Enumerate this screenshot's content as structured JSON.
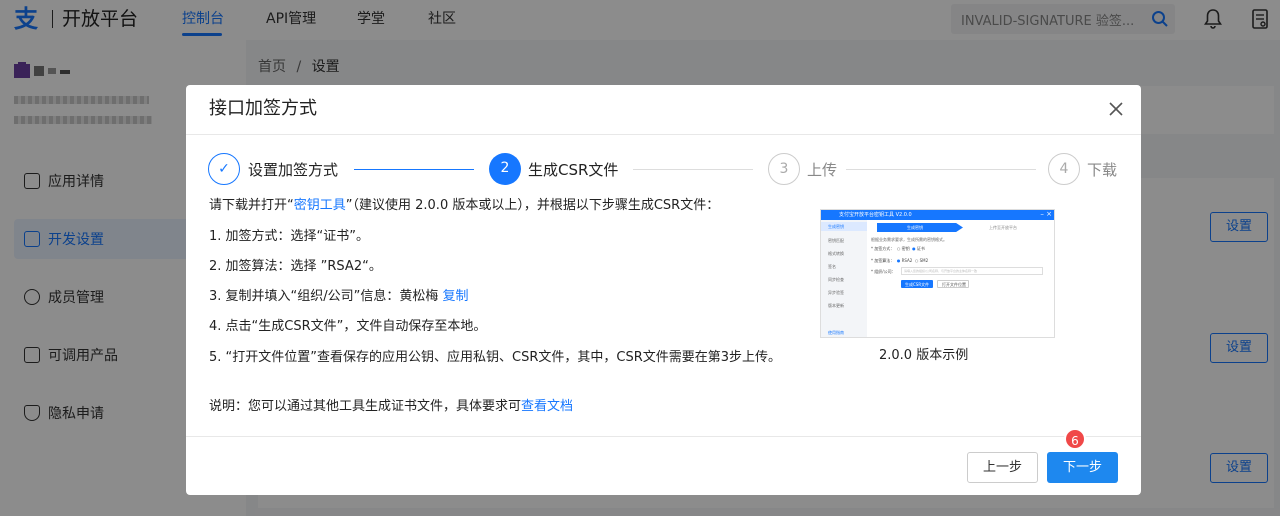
{
  "header": {
    "logo_glyph": "支",
    "logo_text": "开放平台",
    "nav": [
      "控制台",
      "API管理",
      "学堂",
      "社区"
    ],
    "search_text": "INVALID-SIGNATURE 验签..."
  },
  "sidebar": {
    "items": [
      {
        "label": "应用详情",
        "icon": "chart-icon"
      },
      {
        "label": "开发设置",
        "icon": "settings-panel-icon"
      },
      {
        "label": "成员管理",
        "icon": "user-icon"
      },
      {
        "label": "可调用产品",
        "icon": "link-icon"
      },
      {
        "label": "隐私申请",
        "icon": "shield-icon"
      }
    ]
  },
  "breadcrumb": {
    "home": "首页",
    "sep": "/",
    "current": "设置"
  },
  "background_buttons": [
    "设置",
    "设置",
    "设置"
  ],
  "modal": {
    "title": "接口加签方式",
    "steps": [
      {
        "num": "✓",
        "label": "设置加签方式",
        "state": "done"
      },
      {
        "num": "2",
        "label": "生成CSR文件",
        "state": "active"
      },
      {
        "num": "3",
        "label": "上传",
        "state": "pending"
      },
      {
        "num": "4",
        "label": "下载",
        "state": "pending"
      }
    ],
    "intro_pre": "请下载并打开“",
    "intro_link": "密钥工具",
    "intro_post": "”（建议使用 2.0.0 版本或以上），并根据以下步骤生成CSR文件：",
    "line1": "1. 加签方式：选择“证书”。",
    "line2": "2. 加签算法：选择 ”RSA2“。",
    "line3_pre": "3. 复制并填入“组织/公司”信息：黄松梅 ",
    "line3_link": "复制",
    "line4": "4. 点击“生成CSR文件”，文件自动保存至本地。",
    "line5": "5. “打开文件位置”查看保存的应用公钥、应用私钥、CSR文件，其中，CSR文件需要在第3步上传。",
    "note_pre": "说明：您可以通过其他工具生成证书文件，具体要求可",
    "note_link": "查看文档",
    "preview_caption": "2.0.0 版本示例",
    "preview": {
      "title": "支付宝开放平台密钥工具 V2.0.0",
      "side": [
        "生成密钥",
        "密钥匹配",
        "格式转换",
        "签名",
        "同步检查",
        "异步验签",
        "版本更新"
      ],
      "tab1": "生成密钥",
      "tab2": "上传至开放平台",
      "hint": "根据业务需求要求，生成所需的密钥格式。",
      "row1_label": "* 加签方式：",
      "row1_opt1": "密钥",
      "row1_opt2": "证书",
      "row2_label": "* 加签算法：",
      "row2_opt1": "RSA2",
      "row2_opt2": "SM2",
      "row3_label": "* 组织/公司：",
      "row3_placeholder": "请填入您的组织/公司名称，与开放平台的主体名称一致",
      "btn_primary": "生成CSR文件",
      "btn_secondary": "打开文件位置",
      "footer_link": "使用指南"
    },
    "btn_prev": "上一步",
    "btn_next": "下一步"
  },
  "badge": "6",
  "colors": {
    "accent": "#1677ff",
    "badge": "#f04848"
  }
}
